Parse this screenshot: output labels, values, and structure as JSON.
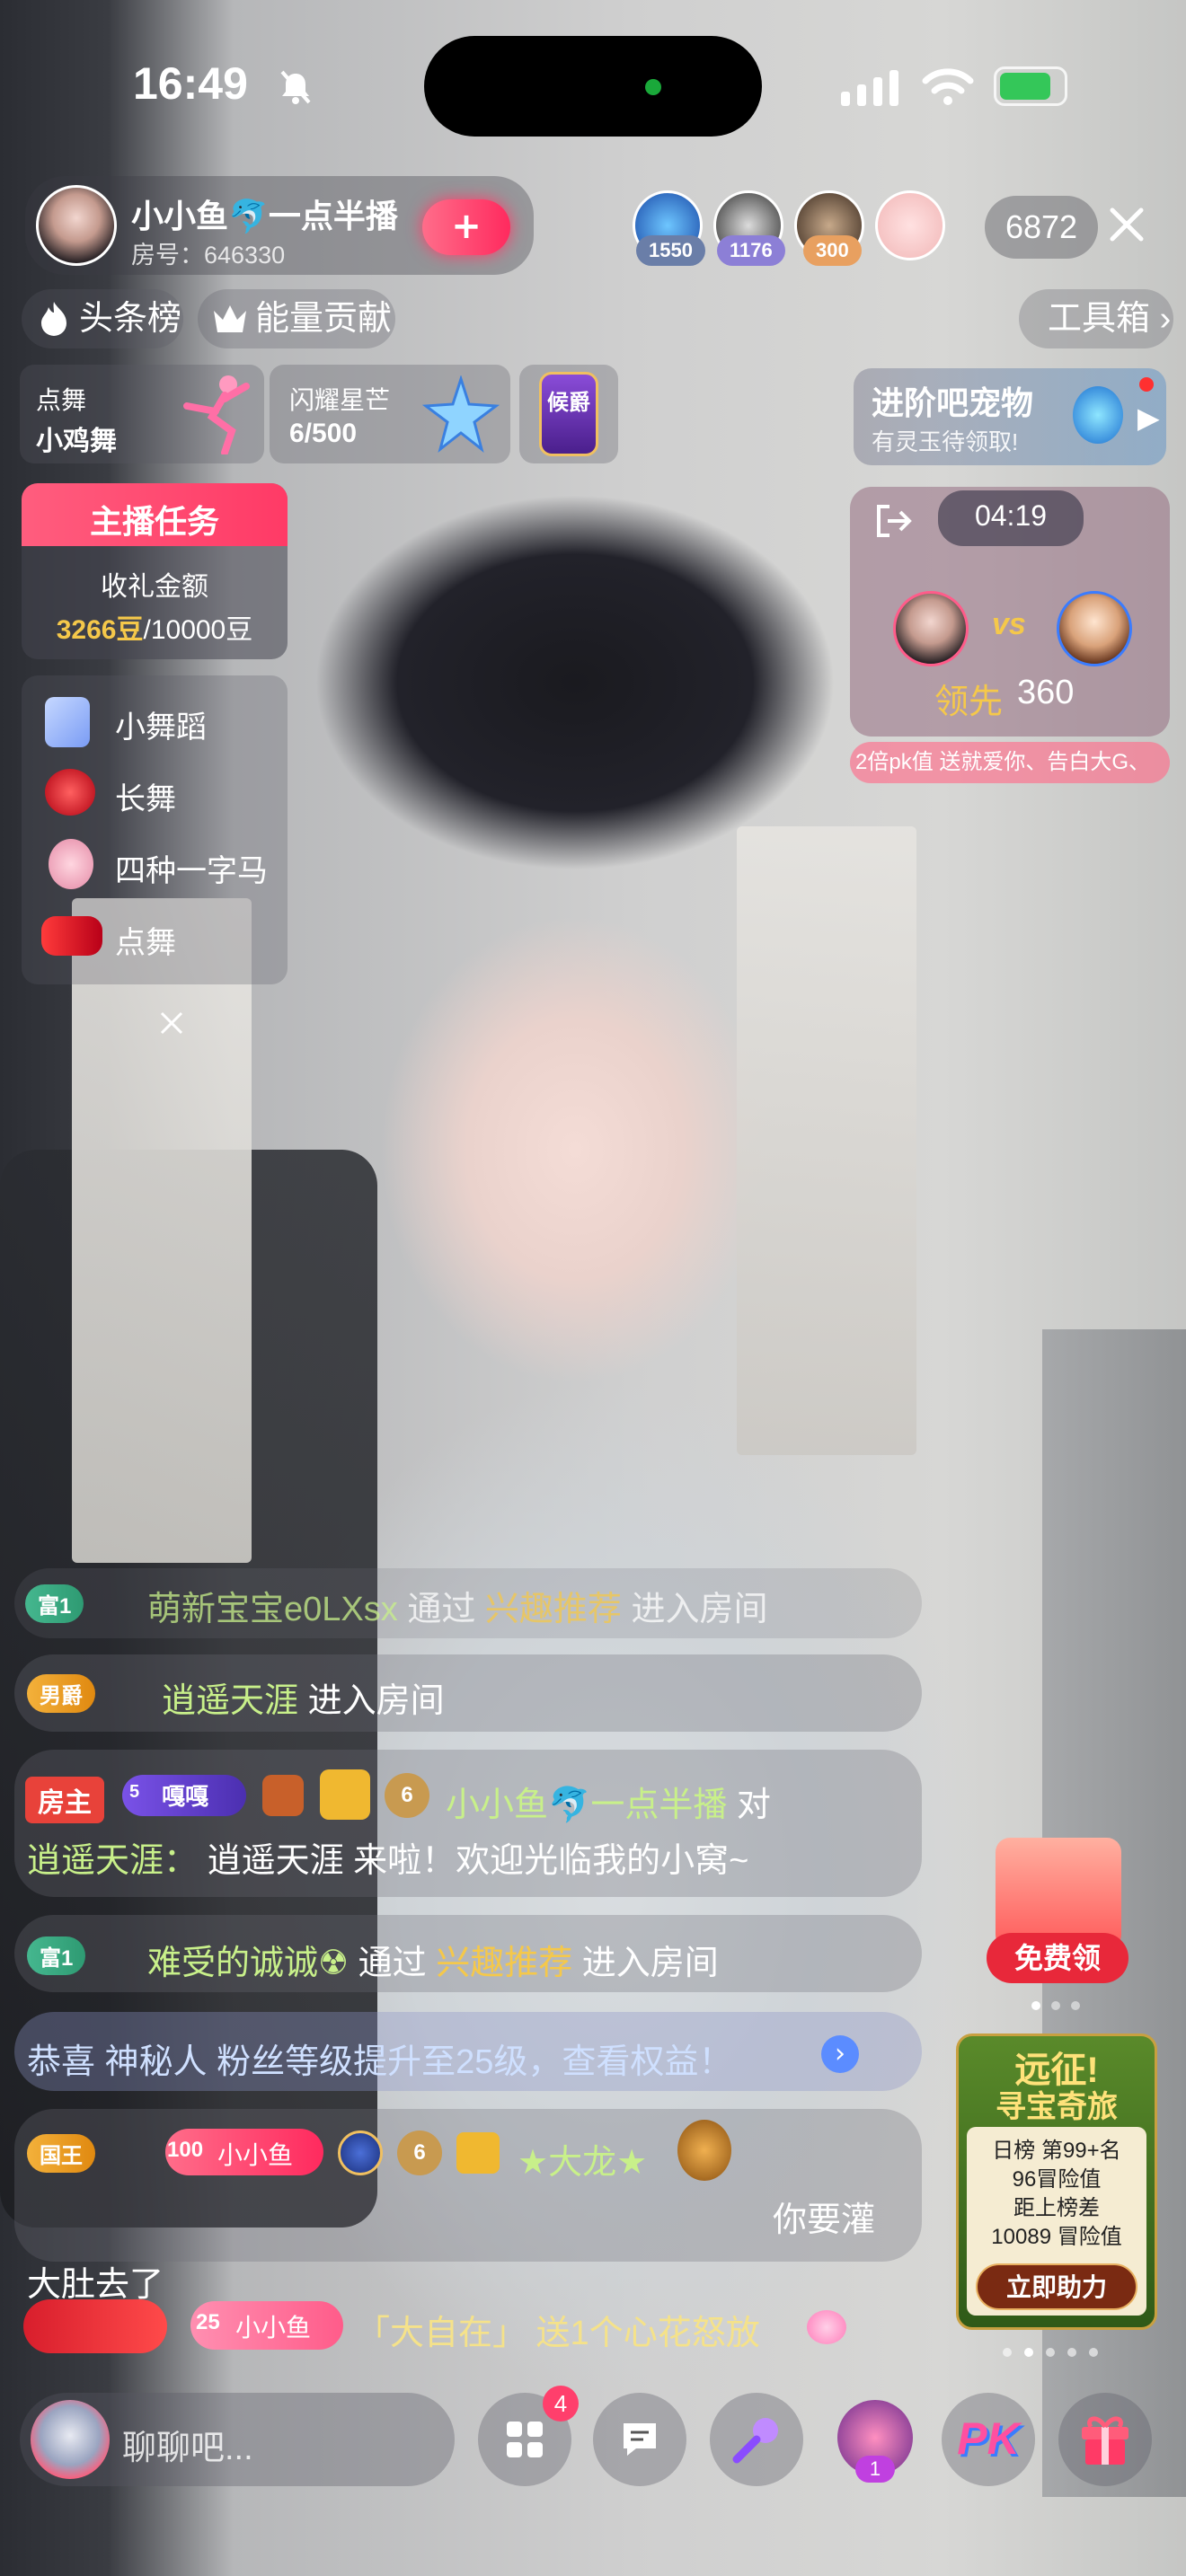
{
  "status_bar": {
    "time": "16:49"
  },
  "streamer": {
    "name": "小小鱼🐬一点半播",
    "room_id": "房号：646330",
    "follow_label": "+"
  },
  "viewers": {
    "badges": [
      "1550",
      "1176",
      "300"
    ],
    "count": "6872"
  },
  "top_row": {
    "tag1": "头条榜",
    "tag2": "能量贡献",
    "toolbox": "工具箱"
  },
  "widgets": {
    "dance": {
      "title": "点舞",
      "subtitle": "小鸡舞"
    },
    "star": {
      "title": "闪耀星芒",
      "subtitle": "6/500"
    },
    "rank_badge": "候爵",
    "pet": {
      "title": "进阶吧宠物",
      "subtitle": "有灵玉待领取!"
    }
  },
  "task": {
    "title": "主播任务",
    "label": "收礼金额",
    "current": "3266豆",
    "total": "/10000豆"
  },
  "menu": {
    "items": [
      "小舞蹈",
      "长舞",
      "四种一字马",
      "点舞"
    ]
  },
  "pk": {
    "timer": "04:19",
    "vs": "vs",
    "status": "领先",
    "score": "360",
    "ticker": "2倍pk值  送就爱你、告白大G、"
  },
  "chat": [
    {
      "badge": "富1",
      "user": "萌新宝宝e0LXsx",
      "mid": "通过",
      "source": "兴趣推荐",
      "tail": "进入房间"
    },
    {
      "badge": "男爵",
      "user": "逍遥天涯",
      "tail": "进入房间"
    },
    {
      "role": "房主",
      "level": "嘎嘎",
      "level_num": "5",
      "badge_num": "6",
      "user": "小小鱼🐬一点半播",
      "mid": "对",
      "target": "逍遥天涯：",
      "text": "逍遥天涯 来啦！欢迎光临我的小窝~"
    },
    {
      "badge": "富1",
      "user": "难受的诚诚☢",
      "mid": "通过",
      "source": "兴趣推荐",
      "tail": "进入房间"
    },
    {
      "system": "恭喜 神秘人 粉丝等级提升至25级，查看权益！"
    },
    {
      "badge": "国王",
      "fan_level": "100",
      "fan_name": "小小鱼",
      "badge_num": "6",
      "user": "★大龙★",
      "text": "你要灌大肚去了"
    },
    {
      "fan_level": "25",
      "fan_name": "小小鱼",
      "gift_text": "「大自在」 送1个心花怒放"
    }
  ],
  "free_gift": {
    "label": "免费领"
  },
  "event": {
    "title": "远征!",
    "subtitle": "寻宝奇旅",
    "rank": "日榜 第99+名",
    "value": "96冒险值",
    "gap_label": "距上榜差",
    "gap": "10089 冒险值",
    "cta": "立即助力"
  },
  "bottom": {
    "chat_placeholder": "聊聊吧...",
    "grid_badge": "4",
    "mic_badge": "1",
    "pk": "PK"
  },
  "colors": {
    "accent_pink": "#ff3f6c",
    "gold": "#f5c84a",
    "chat_user": "#c8f08a"
  }
}
